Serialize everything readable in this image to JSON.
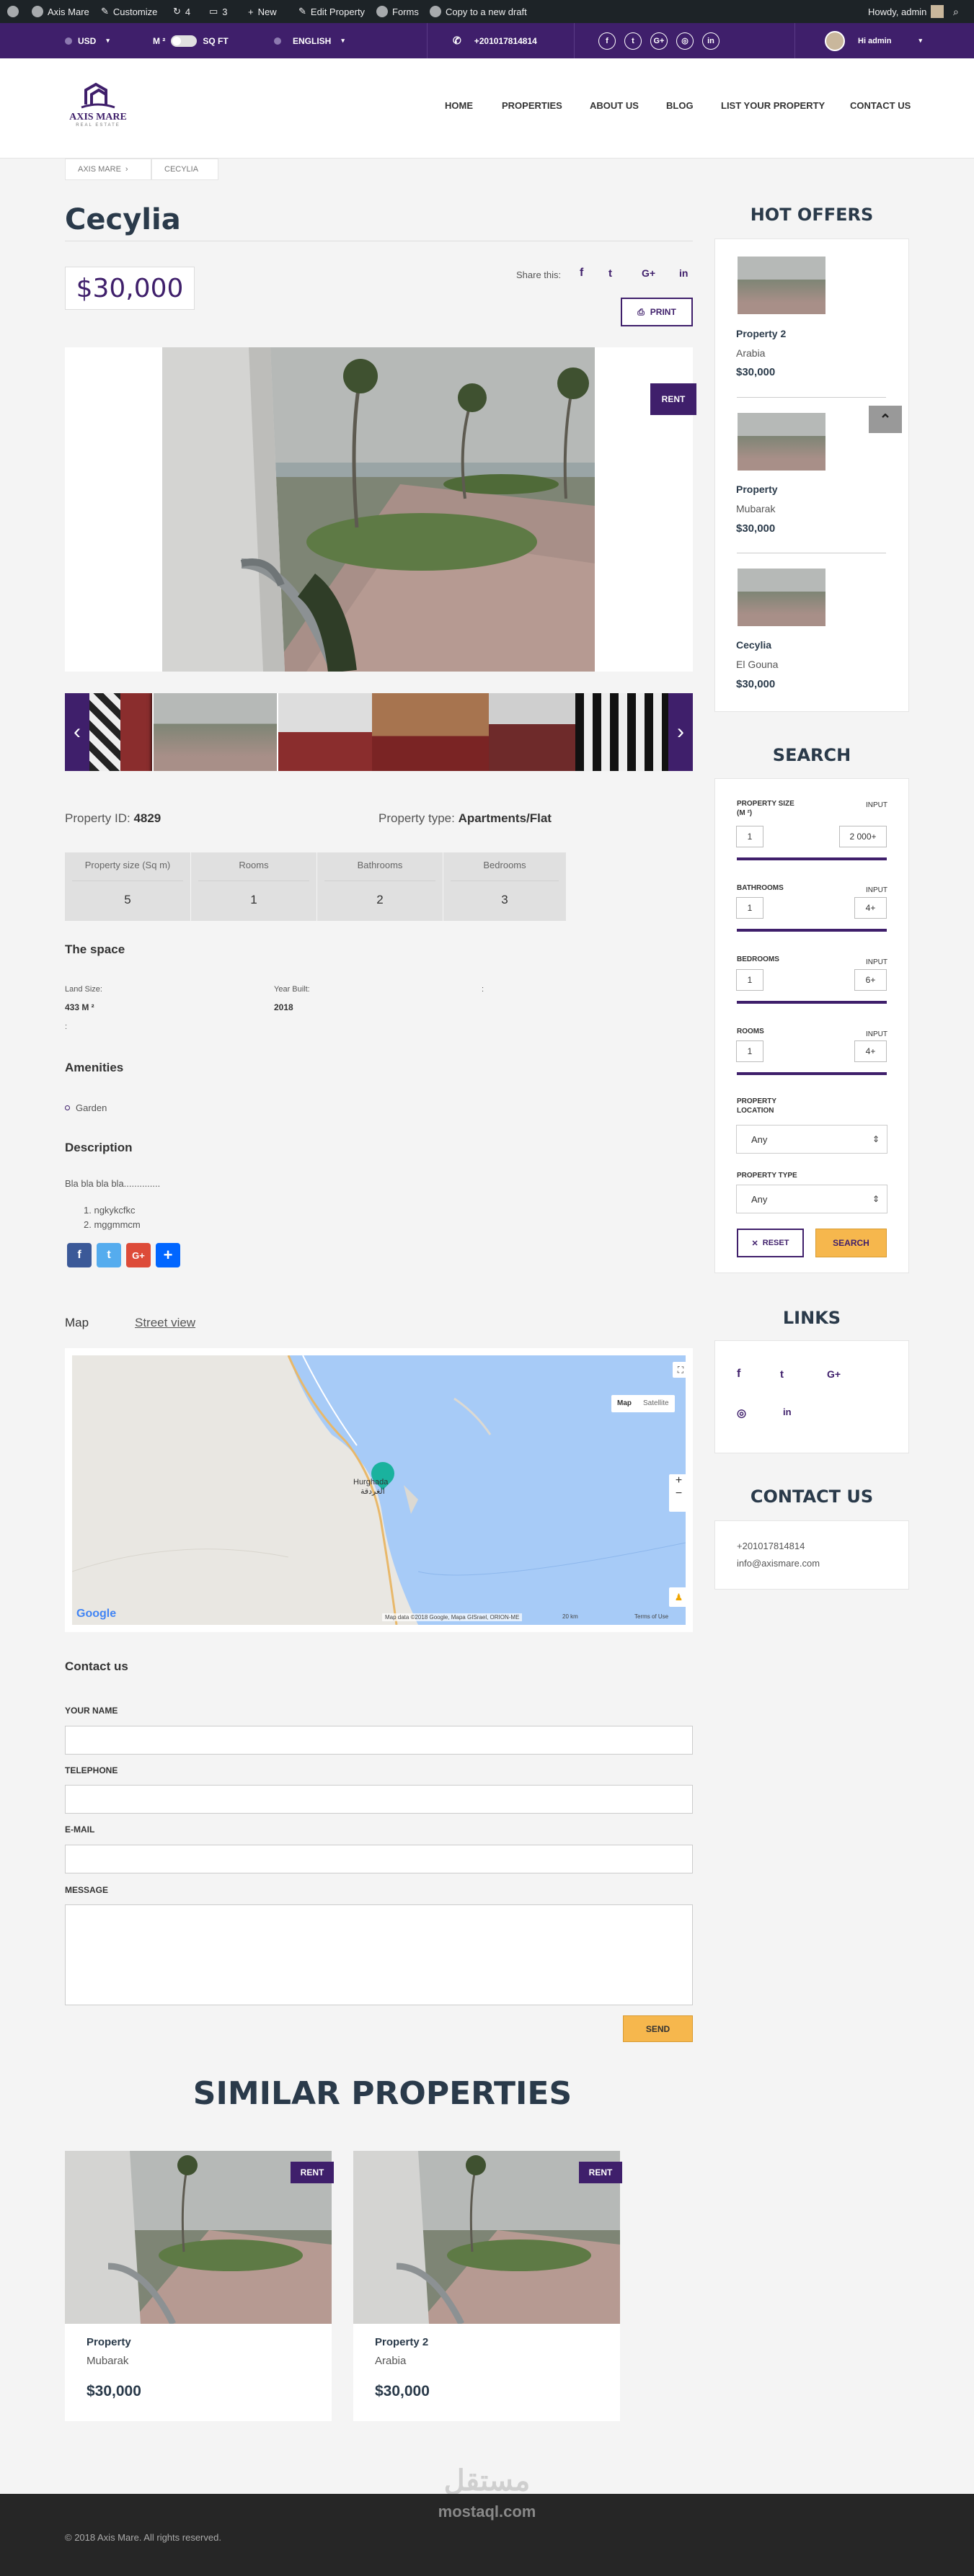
{
  "adminbar": {
    "site": "Axis Mare",
    "customize": "Customize",
    "updates": "4",
    "comments": "3",
    "new": "New",
    "edit": "Edit Property",
    "forms": "Forms",
    "copy": "Copy to a new draft",
    "howdy": "Howdy, admin"
  },
  "topbar": {
    "currency": "USD",
    "unit_left": "M ²",
    "unit_right": "SQ FT",
    "language": "ENGLISH",
    "phone": "+201017814814",
    "user": "Hi admin"
  },
  "logo": {
    "name": "AXIS MARE",
    "tagline": "REAL ESTATE"
  },
  "nav": [
    "HOME",
    "PROPERTIES",
    "ABOUT US",
    "BLOG",
    "LIST YOUR PROPERTY",
    "CONTACT US"
  ],
  "breadcrumb": [
    "AXIS MARE",
    "CECYLIA"
  ],
  "property": {
    "title": "Cecylia",
    "price": "$30,000",
    "share_label": "Share this:",
    "print_label": "PRINT",
    "badge": "RENT",
    "id_label": "Property ID:",
    "id": "4829",
    "type_label": "Property type:",
    "type": "Apartments/Flat",
    "stats": [
      {
        "label": "Property size (Sq m)",
        "value": "5"
      },
      {
        "label": "Rooms",
        "value": "1"
      },
      {
        "label": "Bathrooms",
        "value": "2"
      },
      {
        "label": "Bedrooms",
        "value": "3"
      }
    ],
    "space_title": "The space",
    "land_label": "Land Size:",
    "land_value": "433 M ²",
    "year_label": "Year Built:",
    "year_value": "2018",
    "colon1": ":",
    "colon2": ":",
    "amenities_title": "Amenities",
    "amenity": "Garden",
    "description_title": "Description",
    "description": "Bla bla bla bla..............",
    "list": [
      "ngkykcfkc",
      "mggmmcm"
    ]
  },
  "map": {
    "tab_map": "Map",
    "tab_street": "Street view",
    "btn_map": "Map",
    "btn_sat": "Satellite",
    "place": "Hurghada",
    "place_ar": "الغردقة",
    "attribution": "Map data ©2018 Google, Mapa GISrael, ORION-ME",
    "scale": "20 km",
    "terms": "Terms of Use",
    "google": "Google"
  },
  "contact_form": {
    "title": "Contact us",
    "name": "YOUR NAME",
    "phone": "TELEPHONE",
    "email": "E-MAIL",
    "message": "MESSAGE",
    "send": "SEND"
  },
  "similar": {
    "title": "SIMILAR PROPERTIES",
    "items": [
      {
        "name": "Property",
        "location": "Mubarak",
        "price": "$30,000",
        "badge": "RENT"
      },
      {
        "name": "Property 2",
        "location": "Arabia",
        "price": "$30,000",
        "badge": "RENT"
      }
    ]
  },
  "sidebar": {
    "hot_title": "HOT OFFERS",
    "hot": [
      {
        "name": "Property 2",
        "location": "Arabia",
        "price": "$30,000"
      },
      {
        "name": "Property",
        "location": "Mubarak",
        "price": "$30,000"
      },
      {
        "name": "Cecylia",
        "location": "El Gouna",
        "price": "$30,000"
      }
    ],
    "search_title": "SEARCH",
    "size_label": "PROPERTY SIZE",
    "size_unit": "(M ²)",
    "input": "INPUT",
    "size_min": "1",
    "size_max": "2 000+",
    "bath_label": "BATHROOMS",
    "bath_min": "1",
    "bath_max": "4+",
    "bed_label": "BEDROOMS",
    "bed_min": "1",
    "bed_max": "6+",
    "rooms_label": "ROOMS",
    "rooms_min": "1",
    "rooms_max": "4+",
    "location_label_1": "PROPERTY",
    "location_label_2": "LOCATION",
    "location_value": "Any",
    "type_label": "PROPERTY TYPE",
    "type_value": "Any",
    "reset": "RESET",
    "search": "SEARCH",
    "links_title": "LINKS",
    "contact_title": "CONTACT US",
    "phone": "+201017814814",
    "email": "info@axismare.com"
  },
  "watermark": {
    "ar": "مستقل",
    "en": "mostaql.com"
  },
  "footer": {
    "copyright": "© 2018 Axis Mare. All rights reserved."
  },
  "colors": {
    "primary": "#3f1f6b",
    "accent": "#f6b74d",
    "dark": "#1d2327"
  }
}
